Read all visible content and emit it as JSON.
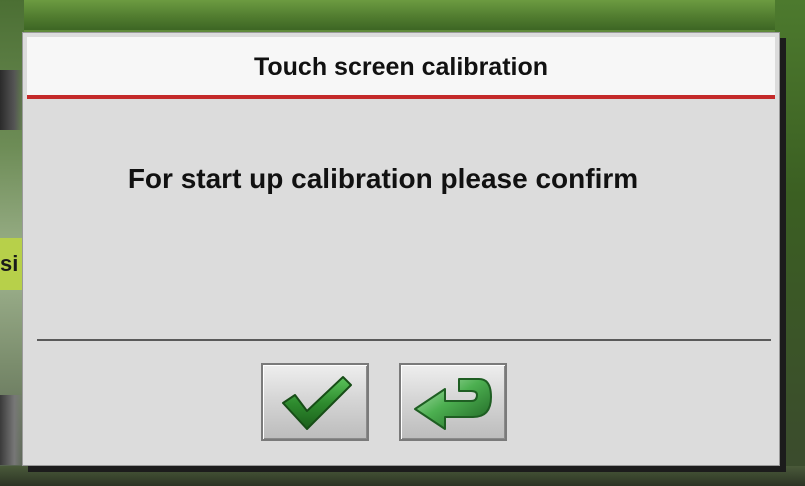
{
  "dialog": {
    "title": "Touch screen calibration",
    "message": "For start up calibration please confirm"
  },
  "background": {
    "side_label": "si"
  },
  "buttons": {
    "confirm_icon": "checkmark-icon",
    "back_icon": "return-arrow-icon"
  },
  "colors": {
    "header_accent": "#c42a2a",
    "dialog_bg": "#dcdcdc",
    "icon_green": "#2e8b2e"
  }
}
